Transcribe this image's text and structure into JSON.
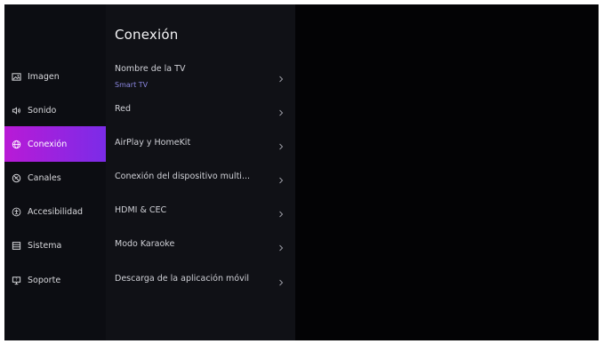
{
  "sidebar": {
    "items": [
      {
        "label": "Imagen",
        "icon": "picture-icon"
      },
      {
        "label": "Sonido",
        "icon": "speaker-icon"
      },
      {
        "label": "Conexión",
        "icon": "globe-icon",
        "active": true
      },
      {
        "label": "Canales",
        "icon": "satellite-icon"
      },
      {
        "label": "Accesibilidad",
        "icon": "accessibility-icon"
      },
      {
        "label": "Sistema",
        "icon": "list-icon"
      },
      {
        "label": "Soporte",
        "icon": "support-icon"
      }
    ]
  },
  "panel": {
    "title": "Conexión",
    "rows": [
      {
        "label": "Nombre de la TV",
        "value": "Smart TV"
      },
      {
        "label": "Red"
      },
      {
        "label": "AirPlay y HomeKit"
      },
      {
        "label": "Conexión del dispositivo multi..."
      },
      {
        "label": "HDMI & CEC"
      },
      {
        "label": "Modo Karaoke"
      },
      {
        "label": "Descarga de la aplicación móvil"
      }
    ]
  },
  "colors": {
    "accent_start": "#b91ad6",
    "accent_end": "#7a2ce8",
    "subtext": "#8a86e0"
  }
}
